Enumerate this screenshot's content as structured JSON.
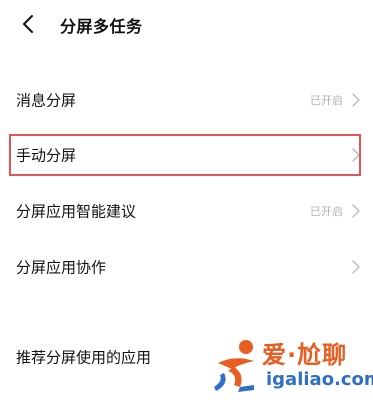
{
  "header": {
    "title": "分屏多任务",
    "back_icon": "chevron-left-icon"
  },
  "settings": {
    "items": [
      {
        "label": "消息分屏",
        "status": "已开启",
        "chevron_icon": "chevron-right-icon"
      },
      {
        "label": "手动分屏",
        "status": "",
        "chevron_icon": "chevron-right-icon",
        "highlighted": true
      },
      {
        "label": "分屏应用智能建议",
        "status": "已开启",
        "chevron_icon": "chevron-right-icon"
      },
      {
        "label": "分屏应用协作",
        "status": "",
        "chevron_icon": "chevron-right-icon"
      },
      {
        "label": "推荐分屏使用的应用",
        "status": "",
        "chevron_icon": ""
      }
    ]
  },
  "watermark": {
    "title": "爱·尬聊",
    "url": "igaliao.com"
  },
  "colors": {
    "highlight_border": "#e05555",
    "status_text": "#b3b3b3",
    "watermark_orange": "#e85d20",
    "watermark_blue": "#2f6fc4"
  }
}
